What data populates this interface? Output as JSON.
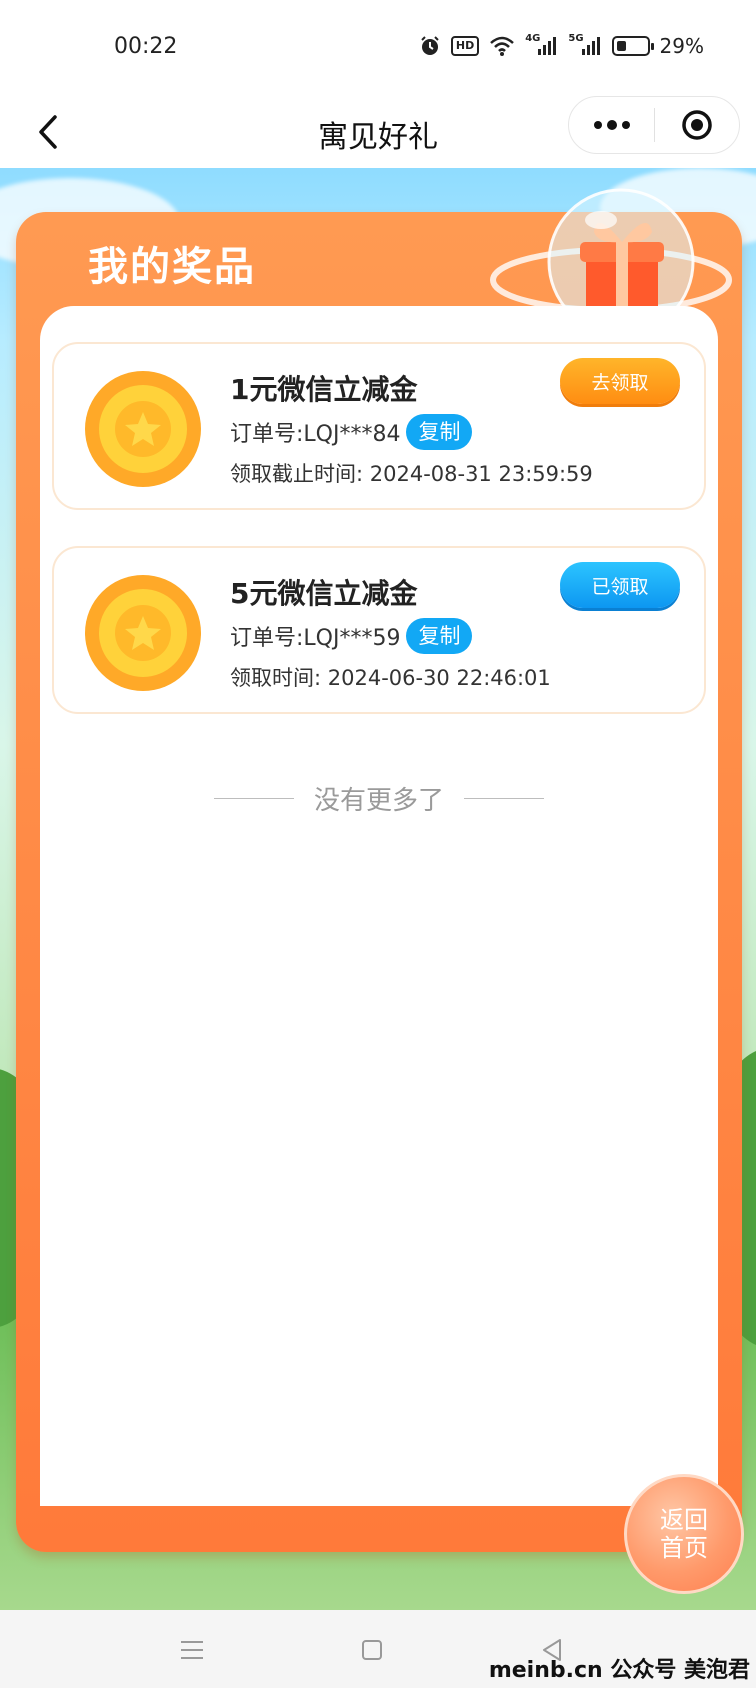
{
  "status_bar": {
    "time": "00:22",
    "network_1": "4G",
    "network_2": "5G",
    "hd_label": "HD",
    "battery_percent": "29%",
    "battery_level": 0.29
  },
  "nav": {
    "title": "寓见好礼"
  },
  "panel": {
    "title": "我的奖品"
  },
  "prizes": [
    {
      "name": "1元微信立减金",
      "order": "订单号:LQJ***84",
      "copy_label": "复制",
      "time": "领取截止时间: 2024-08-31 23:59:59",
      "action_label": "去领取"
    },
    {
      "name": "5元微信立减金",
      "order": "订单号:LQJ***59",
      "copy_label": "复制",
      "time": "领取时间: 2024-06-30 22:46:01",
      "action_label": "已领取"
    }
  ],
  "list_end_text": "没有更多了",
  "home_fab": {
    "line1": "返回",
    "line2": "首页"
  },
  "watermark": "meinb.cn 公众号 美泡君",
  "colors": {
    "panel_orange": "#ff8a45",
    "claim_orange": "#ff9d1a",
    "claimed_blue": "#12a8f5",
    "copy_blue": "#12a8f5"
  }
}
